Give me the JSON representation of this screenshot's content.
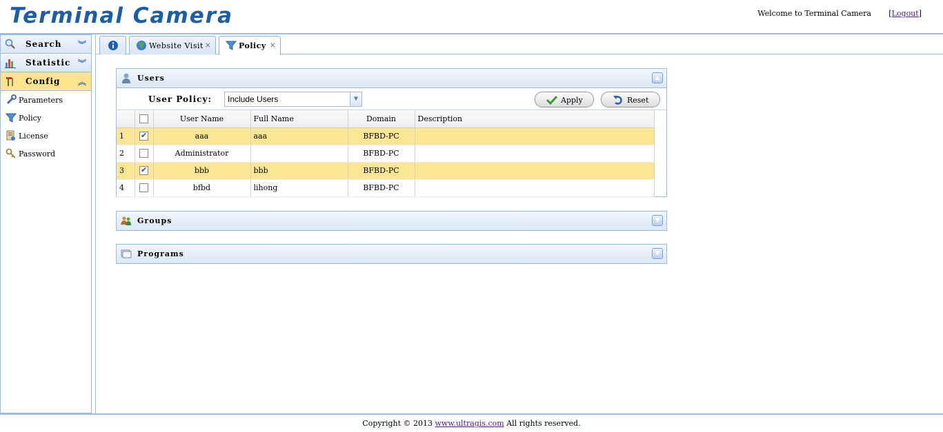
{
  "header": {
    "logo": "Terminal Camera",
    "welcome": "Welcome to Terminal Camera",
    "logout_open": "[",
    "logout": "Logout",
    "logout_close": "]"
  },
  "sidebar": {
    "sections": [
      {
        "label": "Search",
        "icon": "magnifier-icon",
        "expanded": false
      },
      {
        "label": "Statistic",
        "icon": "bar-chart-icon",
        "expanded": false
      },
      {
        "label": "Config",
        "icon": "tools-icon",
        "expanded": true
      }
    ],
    "config_items": [
      {
        "label": "Parameters",
        "icon": "wrench-icon"
      },
      {
        "label": "Policy",
        "icon": "filter-icon"
      },
      {
        "label": "License",
        "icon": "license-icon"
      },
      {
        "label": "Password",
        "icon": "key-icon"
      }
    ]
  },
  "tabs": [
    {
      "label": "",
      "icon": "info-icon"
    },
    {
      "label": "Website Visit",
      "icon": "globe-icon",
      "closable": true
    },
    {
      "label": "Policy",
      "icon": "filter-icon",
      "closable": true,
      "active": true
    }
  ],
  "users_panel": {
    "title": "Users",
    "policy_label": "User Policy:",
    "policy_value": "Include Users",
    "apply": "Apply",
    "reset": "Reset",
    "columns": [
      "User Name",
      "Full Name",
      "Domain",
      "Description"
    ],
    "rows": [
      {
        "num": "1",
        "checked": true,
        "user": "aaa",
        "full": "aaa",
        "domain": "BFBD-PC",
        "desc": ""
      },
      {
        "num": "2",
        "checked": false,
        "user": "Administrator",
        "full": "",
        "domain": "BFBD-PC",
        "desc": ""
      },
      {
        "num": "3",
        "checked": true,
        "user": "bbb",
        "full": "bbb",
        "domain": "BFBD-PC",
        "desc": ""
      },
      {
        "num": "4",
        "checked": false,
        "user": "bfbd",
        "full": "lihong",
        "domain": "BFBD-PC",
        "desc": ""
      }
    ]
  },
  "groups_panel": {
    "title": "Groups"
  },
  "programs_panel": {
    "title": "Programs"
  },
  "footer": {
    "prefix": "Copyright © 2013",
    "link": "www.ultragis.com",
    "suffix": "All rights reserved."
  },
  "colors": {
    "accent": "#1a5ea8",
    "border": "#99bbe8",
    "selected_row": "#fbe694"
  }
}
